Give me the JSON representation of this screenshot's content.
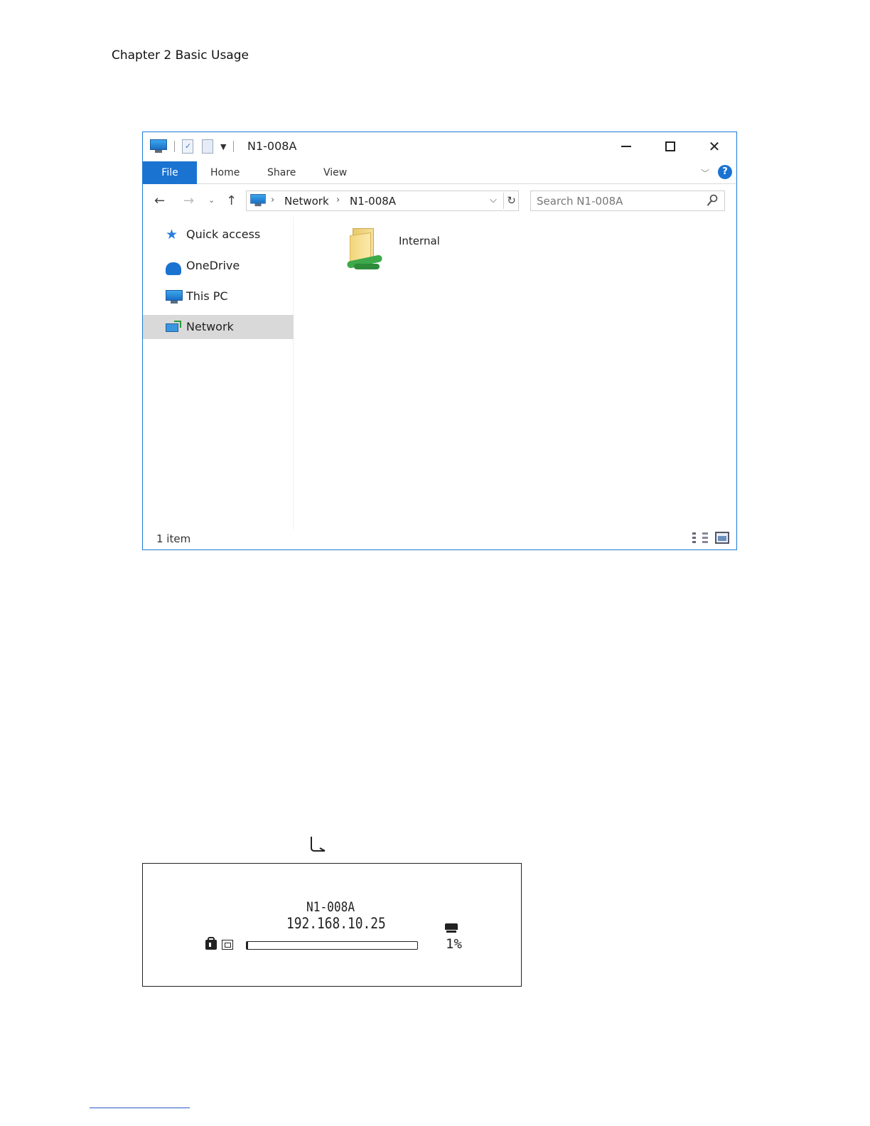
{
  "page": {
    "chapter_header": "Chapter 2 Basic Usage"
  },
  "explorer": {
    "window_title": "N1-008A",
    "ribbon_tabs": [
      {
        "label": "File"
      },
      {
        "label": "Home"
      },
      {
        "label": "Share"
      },
      {
        "label": "View"
      }
    ],
    "address": {
      "crumbs": [
        "Network",
        "N1-008A"
      ]
    },
    "search": {
      "placeholder": "Search N1-008A"
    },
    "nav_pane": {
      "items": [
        {
          "label": "Quick access",
          "icon": "star-icon"
        },
        {
          "label": "OneDrive",
          "icon": "cloud-icon"
        },
        {
          "label": "This PC",
          "icon": "computer-icon"
        },
        {
          "label": "Network",
          "icon": "network-icon",
          "selected": true
        }
      ]
    },
    "content": {
      "items": [
        {
          "label": "Internal",
          "icon": "network-folder-icon"
        }
      ]
    },
    "status_bar": {
      "item_count": "1 item"
    },
    "colors": {
      "accent": "#1a73d1",
      "selected_bg": "#d9d9d9"
    }
  },
  "lcd_panel": {
    "device_name": "N1-008A",
    "ip_address": "192.168.10.25",
    "usage_percent_label": "1%",
    "usage_fraction": 0.01
  }
}
